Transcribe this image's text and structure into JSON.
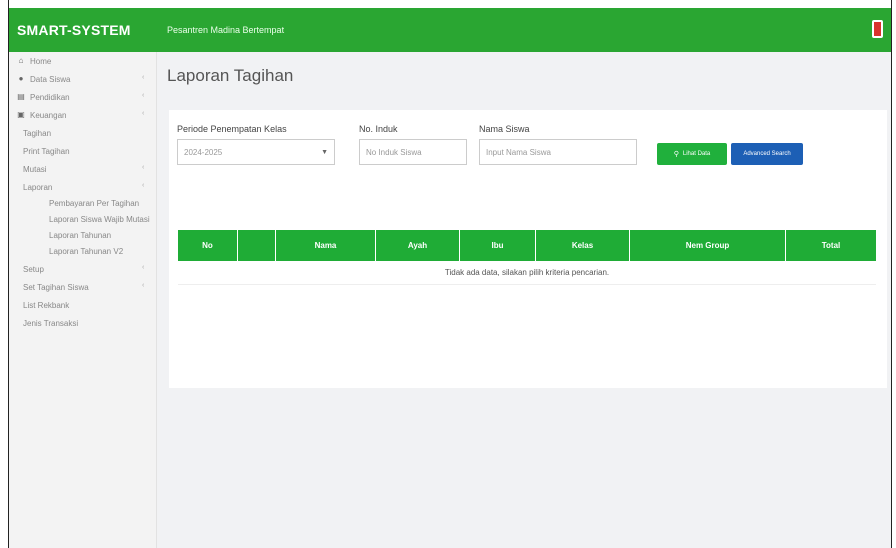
{
  "app": {
    "brand": "SMART-SYSTEM",
    "school": "Pesantren Madina Bertempat"
  },
  "sidebar": {
    "items": [
      {
        "label": "Home",
        "icon": "home-icon",
        "has_chevron": false,
        "level": 0
      },
      {
        "label": "Data Siswa",
        "icon": "user-icon",
        "has_chevron": true,
        "level": 0
      },
      {
        "label": "Pendidikan",
        "icon": "book-icon",
        "has_chevron": true,
        "level": 0
      },
      {
        "label": "Keuangan",
        "icon": "money-icon",
        "has_chevron": true,
        "level": 0
      },
      {
        "label": "Tagihan",
        "level": 1
      },
      {
        "label": "Print Tagihan",
        "level": 1
      },
      {
        "label": "Mutasi",
        "has_chevron": true,
        "level": 1
      },
      {
        "label": "Laporan",
        "has_chevron": true,
        "level": 1
      },
      {
        "label": "Pembayaran Per Tagihan",
        "level": 2
      },
      {
        "label": "Laporan Siswa Wajib Mutasi",
        "level": 2
      },
      {
        "label": "Laporan Tahunan",
        "level": 2
      },
      {
        "label": "Laporan Tahunan V2",
        "level": 2
      },
      {
        "label": "Setup",
        "has_chevron": true,
        "level": 1
      },
      {
        "label": "Set Tagihan Siswa",
        "has_chevron": true,
        "level": 1
      },
      {
        "label": "List Rekbank",
        "level": 1
      },
      {
        "label": "Jenis Transaksi",
        "level": 1
      }
    ]
  },
  "page": {
    "title": "Laporan Tagihan"
  },
  "filters": {
    "period_label": "Periode Penempatan Kelas",
    "period_value": "2024-2025",
    "nis_label": "No. Induk",
    "nis_placeholder": "No Induk Siswa",
    "name_label": "Nama Siswa",
    "name_placeholder": "Input Nama Siswa",
    "search_button": "Lihat Data",
    "advanced_button": "Advanced Search"
  },
  "table": {
    "columns": [
      "No",
      "",
      "Nama",
      "Ayah",
      "Ibu",
      "Kelas",
      "Nem Group",
      "Total"
    ],
    "empty_message": "Tidak ada data, silakan pilih kriteria pencarian."
  },
  "colors": {
    "brand_green": "#2aa632",
    "table_green": "#1fac36",
    "button_blue": "#1d5fb5",
    "power_red": "#d9332d"
  }
}
